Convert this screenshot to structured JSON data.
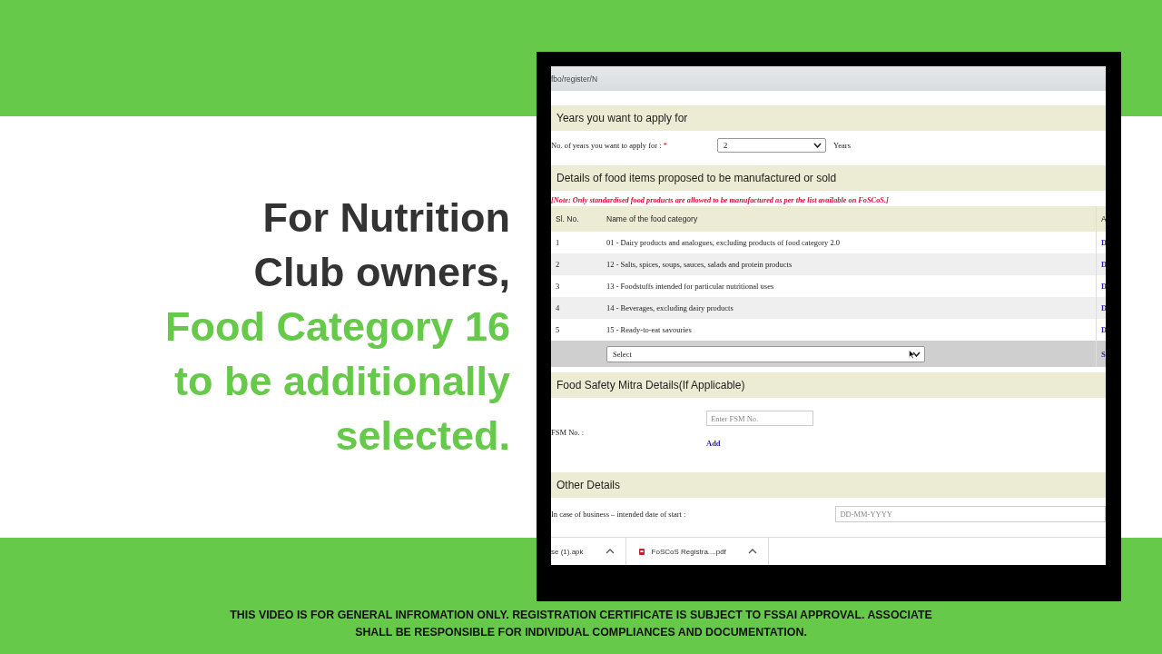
{
  "headline": [
    {
      "color": "#333333",
      "lines": [
        "For Nutrition",
        "Club owners,"
      ]
    },
    {
      "color": "#66c94a",
      "lines": [
        "Food Category 16",
        "to be additionally",
        "selected."
      ]
    }
  ],
  "browser": {
    "address": "fbo/register/N",
    "sections": [
      {
        "kind": "years",
        "title": "Years you want to apply for",
        "label": "No. of years you want to apply for :",
        "required_mark": "*",
        "value": "2",
        "unit": "Years"
      },
      {
        "kind": "food",
        "title": "Details of food items proposed to be manufactured or sold",
        "note": "[Note: Only standardised food products are allowed to be manufactured as per the list available on FoSCoS.]",
        "columns": [
          "Sl. No.",
          "Name of the food category",
          "A"
        ],
        "rows": [
          {
            "cells": [
              "1",
              "01 - Dairy products and analogues, excluding products of food category 2.0",
              "D"
            ]
          },
          {
            "cells": [
              "2",
              "12 - Salts, spices, soups, sauces, salads and protein products",
              "D"
            ]
          },
          {
            "cells": [
              "3",
              "13 - Foodstuffs intended for particular nutritional uses",
              "D"
            ]
          },
          {
            "cells": [
              "4",
              "14 - Beverages, excluding dairy products",
              "D"
            ]
          },
          {
            "cells": [
              "5",
              "15 - Ready-to-eat savouries",
              "D"
            ]
          }
        ],
        "select": {
          "value": "Select",
          "action": "S"
        }
      },
      {
        "kind": "fsm",
        "title": "Food Safety Mitra Details(If Applicable)",
        "label": "FSM No. :",
        "placeholder": "Enter FSM No.",
        "link": "Add"
      },
      {
        "kind": "other",
        "title": "Other Details",
        "label": "In case of business – intended date of start :",
        "placeholder": "DD-MM-YYYY"
      }
    ],
    "downloads": [
      {
        "kind": "file",
        "name": "se (1).apk"
      },
      {
        "kind": "pdf",
        "name": "FoSCoS Registra....pdf"
      }
    ]
  },
  "disclaimer": [
    "THIS VIDEO IS FOR GENERAL INFROMATION ONLY. REGISTRATION CERTIFICATE IS SUBJECT TO FSSAI APPROVAL. ASSOCIATE",
    "SHALL BE RESPONSIBLE FOR INDIVIDUAL COMPLIANCES AND DOCUMENTATION."
  ]
}
